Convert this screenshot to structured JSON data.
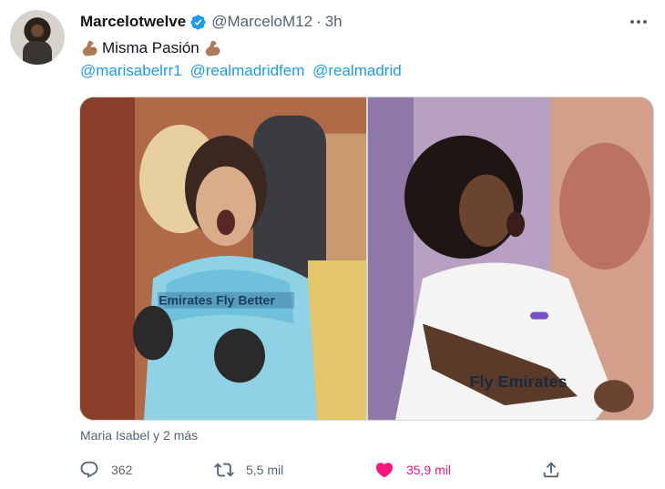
{
  "tweet": {
    "author": {
      "display_name": "Marcelotwelve",
      "verified": true,
      "handle": "@MarceloM12",
      "separator": "·",
      "time": "3h"
    },
    "text": "Misma Pasión",
    "emoji": "muscle-emoji",
    "mentions": [
      "@marisabelrr1",
      "@realmadridfem",
      "@realmadrid"
    ],
    "tagged_people": "Maria Isabel y 2 más",
    "media": {
      "count": 2,
      "left_photo_text": "Emirates Fly Better",
      "right_photo_text": "Fly Emirates"
    },
    "stats": {
      "replies": "362",
      "retweets": "5,5 mil",
      "likes": "35,9 mil",
      "liked": true
    }
  },
  "colors": {
    "link": "#1d9bf0",
    "secondary_text": "#536471",
    "like": "#f91880",
    "verified": "#1d9bf0"
  },
  "icons": [
    "more-icon",
    "verified-badge-icon",
    "reply-icon",
    "retweet-icon",
    "heart-icon",
    "share-icon"
  ]
}
